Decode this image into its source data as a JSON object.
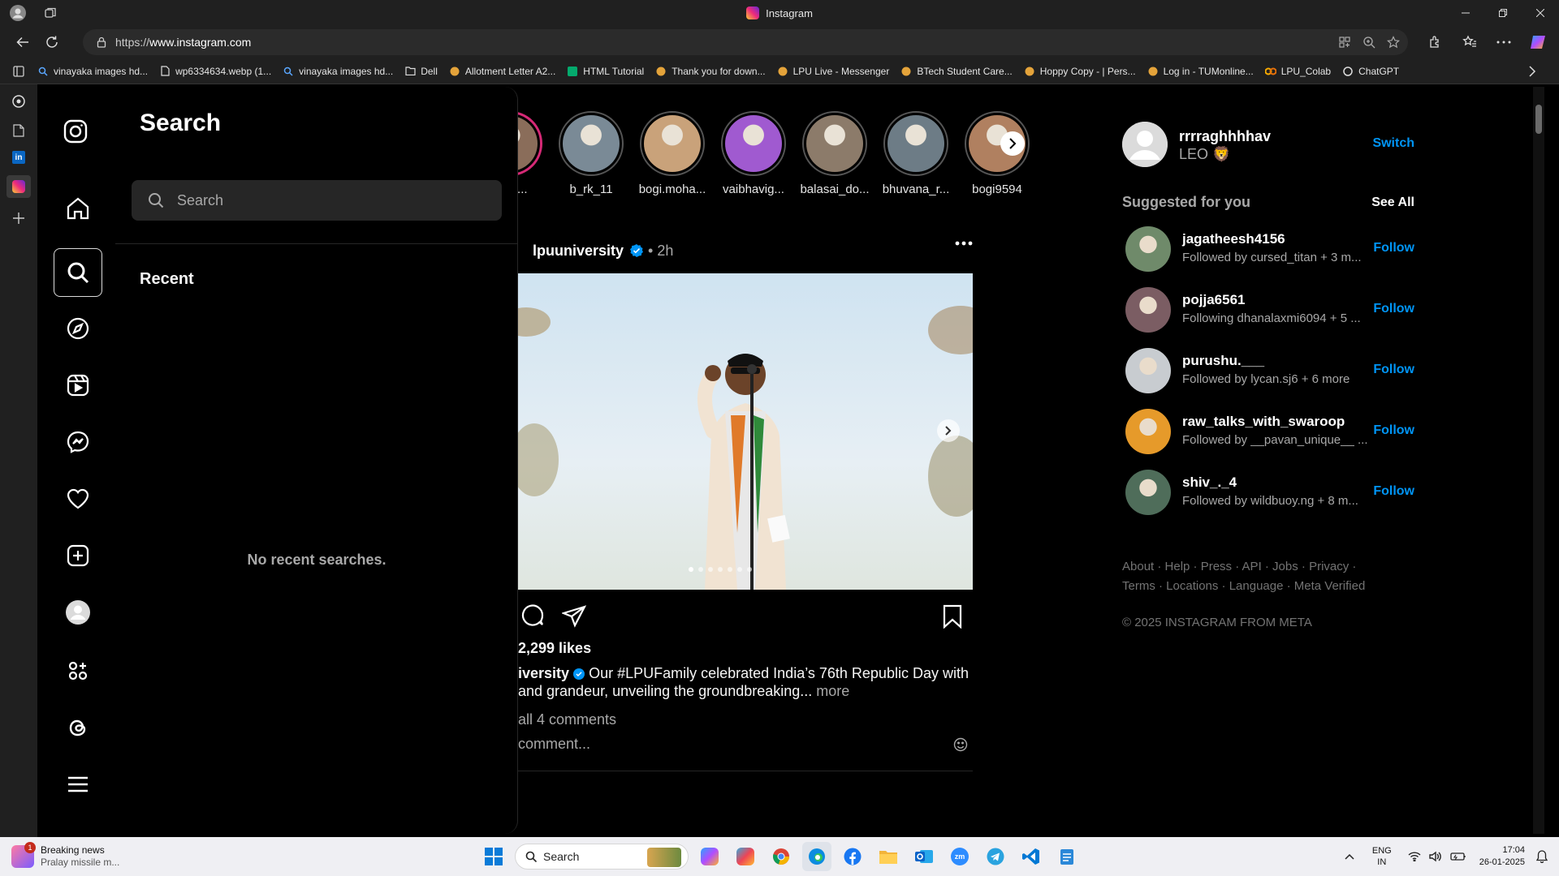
{
  "browser": {
    "window_title": "Instagram",
    "url_scheme": "https://",
    "url_host": "www.instagram.com",
    "bookmarks": [
      {
        "label": "vinayaka images hd...",
        "icon": "search-icon"
      },
      {
        "label": "wp6334634.webp (1...",
        "icon": "file-icon"
      },
      {
        "label": "vinayaka images hd...",
        "icon": "search-icon"
      },
      {
        "label": "Dell",
        "icon": "folder-icon"
      },
      {
        "label": "Allotment Letter A2...",
        "icon": "site-icon"
      },
      {
        "label": "HTML Tutorial",
        "icon": "w3-icon"
      },
      {
        "label": "Thank you for down...",
        "icon": "site-icon"
      },
      {
        "label": "LPU Live - Messenger",
        "icon": "site-icon"
      },
      {
        "label": "BTech Student Care...",
        "icon": "site-icon"
      },
      {
        "label": "Hoppy Copy - | Pers...",
        "icon": "site-icon"
      },
      {
        "label": "Log in - TUMonline...",
        "icon": "site-icon"
      },
      {
        "label": "LPU_Colab",
        "icon": "colab-icon"
      },
      {
        "label": "ChatGPT",
        "icon": "chatgpt-icon"
      }
    ]
  },
  "search_panel": {
    "title": "Search",
    "placeholder": "Search",
    "recent_label": "Recent",
    "empty_text": "No recent searches."
  },
  "stories": [
    {
      "name": "nay.j...",
      "color": "#8a6d5a"
    },
    {
      "name": "b_rk_11",
      "color": "#7a8a96"
    },
    {
      "name": "bogi.moha...",
      "color": "#c9a27a"
    },
    {
      "name": "vaibhavig...",
      "color": "#a05ad0"
    },
    {
      "name": "balasai_do...",
      "color": "#8c7b6a"
    },
    {
      "name": "bhuvana_r...",
      "color": "#6d7c86"
    },
    {
      "name": "bogi9594",
      "color": "#b08060"
    }
  ],
  "post": {
    "username": "lpuuniversity",
    "time": "• 2h",
    "likes": "2,299 likes",
    "caption_user": "iversity",
    "caption_text": "Our #LPUFamily celebrated India’s 76th Republic Day with",
    "caption_line2": "and grandeur, unveiling the groundbreaking...",
    "more_label": "more",
    "comments_label": "all 4 comments",
    "add_comment": "comment...",
    "carousel_count": 7,
    "carousel_index": 1
  },
  "profile": {
    "username": "rrrraghhhhav",
    "name": "LEO 🦁",
    "switch_label": "Switch"
  },
  "suggestions": {
    "title": "Suggested for you",
    "see_all": "See All",
    "items": [
      {
        "username": "jagatheesh4156",
        "sub": "Followed by cursed_titan + 3 m...",
        "action": "Follow",
        "color": "#6f8a6a"
      },
      {
        "username": "pojja6561",
        "sub": "Following dhanalaxmi6094 + 5 ...",
        "action": "Follow",
        "color": "#7b5d63"
      },
      {
        "username": "purushu.___",
        "sub": "Followed by lycan.sj6 + 6 more",
        "action": "Follow",
        "color": "#c8ccd0"
      },
      {
        "username": "raw_talks_with_swaroop",
        "sub": "Followed by __pavan_unique__ ...",
        "action": "Follow",
        "color": "#e69a2a"
      },
      {
        "username": "shiv_._4",
        "sub": "Followed by wildbuoy.ng + 8 m...",
        "action": "Follow",
        "color": "#4f6d5a"
      }
    ]
  },
  "footer": {
    "links": "About · Help · Press · API · Jobs · Privacy · Terms · Locations · Language · Meta Verified",
    "copyright": "© 2025 INSTAGRAM FROM META"
  },
  "taskbar": {
    "news_title": "Breaking news",
    "news_sub": "Pralay missile m...",
    "news_badge": "1",
    "search_label": "Search",
    "lang1": "ENG",
    "lang2": "IN",
    "time": "17:04",
    "date": "26-01-2025"
  },
  "colors": {
    "accent": "#0095f6",
    "story_ring": "#d62976",
    "background": "#000000"
  }
}
